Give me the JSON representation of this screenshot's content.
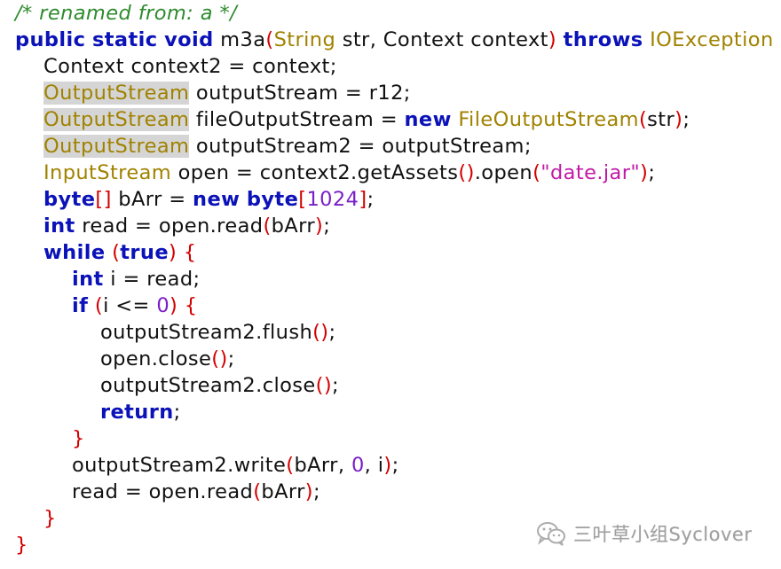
{
  "code": {
    "lines": [
      {
        "indent": 0,
        "tokens": [
          {
            "t": "/* renamed from: a */",
            "c": "comment"
          }
        ]
      },
      {
        "indent": 0,
        "tokens": [
          {
            "t": "public",
            "c": "kw"
          },
          {
            "t": " ",
            "c": "plain"
          },
          {
            "t": "static",
            "c": "kw"
          },
          {
            "t": " ",
            "c": "plain"
          },
          {
            "t": "void",
            "c": "kw"
          },
          {
            "t": " m3a",
            "c": "plain"
          },
          {
            "t": "(",
            "c": "punc"
          },
          {
            "t": "String",
            "c": "type"
          },
          {
            "t": " str, Context context",
            "c": "plain"
          },
          {
            "t": ")",
            "c": "punc"
          },
          {
            "t": " ",
            "c": "plain"
          },
          {
            "t": "throws",
            "c": "kw"
          },
          {
            "t": " ",
            "c": "plain"
          },
          {
            "t": "IOException",
            "c": "type"
          },
          {
            "t": " ",
            "c": "plain"
          },
          {
            "t": "{",
            "c": "punc"
          }
        ]
      },
      {
        "indent": 1,
        "tokens": [
          {
            "t": "Context context2 = context;",
            "c": "plain"
          }
        ]
      },
      {
        "indent": 1,
        "tokens": [
          {
            "t": "OutputStream",
            "c": "type hl"
          },
          {
            "t": " outputStream = r12;",
            "c": "plain"
          }
        ]
      },
      {
        "indent": 1,
        "tokens": [
          {
            "t": "OutputStream",
            "c": "type hl"
          },
          {
            "t": " fileOutputStream = ",
            "c": "plain"
          },
          {
            "t": "new",
            "c": "kw"
          },
          {
            "t": " ",
            "c": "plain"
          },
          {
            "t": "FileOutputStream",
            "c": "type"
          },
          {
            "t": "(",
            "c": "punc"
          },
          {
            "t": "str",
            "c": "plain"
          },
          {
            "t": ")",
            "c": "punc"
          },
          {
            "t": ";",
            "c": "plain"
          }
        ]
      },
      {
        "indent": 1,
        "tokens": [
          {
            "t": "OutputStream",
            "c": "type hl"
          },
          {
            "t": " outputStream2 = outputStream;",
            "c": "plain"
          }
        ]
      },
      {
        "indent": 1,
        "tokens": [
          {
            "t": "InputStream",
            "c": "type"
          },
          {
            "t": " open = context2.getAssets",
            "c": "plain"
          },
          {
            "t": "()",
            "c": "punc"
          },
          {
            "t": ".open",
            "c": "plain"
          },
          {
            "t": "(",
            "c": "punc"
          },
          {
            "t": "\"date.jar\"",
            "c": "str"
          },
          {
            "t": ")",
            "c": "punc"
          },
          {
            "t": ";",
            "c": "plain"
          }
        ]
      },
      {
        "indent": 1,
        "tokens": [
          {
            "t": "byte",
            "c": "kw"
          },
          {
            "t": "[]",
            "c": "punc"
          },
          {
            "t": " bArr = ",
            "c": "plain"
          },
          {
            "t": "new",
            "c": "kw"
          },
          {
            "t": " ",
            "c": "plain"
          },
          {
            "t": "byte",
            "c": "kw"
          },
          {
            "t": "[",
            "c": "punc"
          },
          {
            "t": "1024",
            "c": "num"
          },
          {
            "t": "]",
            "c": "punc"
          },
          {
            "t": ";",
            "c": "plain"
          }
        ]
      },
      {
        "indent": 1,
        "tokens": [
          {
            "t": "int",
            "c": "kw"
          },
          {
            "t": " read = open.read",
            "c": "plain"
          },
          {
            "t": "(",
            "c": "punc"
          },
          {
            "t": "bArr",
            "c": "plain"
          },
          {
            "t": ")",
            "c": "punc"
          },
          {
            "t": ";",
            "c": "plain"
          }
        ]
      },
      {
        "indent": 1,
        "tokens": [
          {
            "t": "while",
            "c": "kw"
          },
          {
            "t": " ",
            "c": "plain"
          },
          {
            "t": "(",
            "c": "punc"
          },
          {
            "t": "true",
            "c": "kw"
          },
          {
            "t": ")",
            "c": "punc"
          },
          {
            "t": " ",
            "c": "plain"
          },
          {
            "t": "{",
            "c": "punc"
          }
        ]
      },
      {
        "indent": 2,
        "tokens": [
          {
            "t": "int",
            "c": "kw"
          },
          {
            "t": " i = read;",
            "c": "plain"
          }
        ]
      },
      {
        "indent": 2,
        "tokens": [
          {
            "t": "if",
            "c": "kw"
          },
          {
            "t": " ",
            "c": "plain"
          },
          {
            "t": "(",
            "c": "punc"
          },
          {
            "t": "i <= ",
            "c": "plain"
          },
          {
            "t": "0",
            "c": "num"
          },
          {
            "t": ")",
            "c": "punc"
          },
          {
            "t": " ",
            "c": "plain"
          },
          {
            "t": "{",
            "c": "punc"
          }
        ]
      },
      {
        "indent": 3,
        "tokens": [
          {
            "t": "outputStream2.flush",
            "c": "plain"
          },
          {
            "t": "()",
            "c": "punc"
          },
          {
            "t": ";",
            "c": "plain"
          }
        ]
      },
      {
        "indent": 3,
        "tokens": [
          {
            "t": "open.close",
            "c": "plain"
          },
          {
            "t": "()",
            "c": "punc"
          },
          {
            "t": ";",
            "c": "plain"
          }
        ]
      },
      {
        "indent": 3,
        "tokens": [
          {
            "t": "outputStream2.close",
            "c": "plain"
          },
          {
            "t": "()",
            "c": "punc"
          },
          {
            "t": ";",
            "c": "plain"
          }
        ]
      },
      {
        "indent": 3,
        "tokens": [
          {
            "t": "return",
            "c": "kw"
          },
          {
            "t": ";",
            "c": "plain"
          }
        ]
      },
      {
        "indent": 2,
        "tokens": [
          {
            "t": "}",
            "c": "punc"
          }
        ]
      },
      {
        "indent": 2,
        "tokens": [
          {
            "t": "outputStream2.write",
            "c": "plain"
          },
          {
            "t": "(",
            "c": "punc"
          },
          {
            "t": "bArr, ",
            "c": "plain"
          },
          {
            "t": "0",
            "c": "num"
          },
          {
            "t": ", i",
            "c": "plain"
          },
          {
            "t": ")",
            "c": "punc"
          },
          {
            "t": ";",
            "c": "plain"
          }
        ]
      },
      {
        "indent": 2,
        "tokens": [
          {
            "t": "read = open.read",
            "c": "plain"
          },
          {
            "t": "(",
            "c": "punc"
          },
          {
            "t": "bArr",
            "c": "plain"
          },
          {
            "t": ")",
            "c": "punc"
          },
          {
            "t": ";",
            "c": "plain"
          }
        ]
      },
      {
        "indent": 1,
        "tokens": [
          {
            "t": "}",
            "c": "punc"
          }
        ]
      },
      {
        "indent": 0,
        "tokens": [
          {
            "t": "}",
            "c": "punc"
          }
        ]
      }
    ]
  },
  "colors": {
    "comment": "#2e8b2e",
    "keyword": "#0b12b8",
    "type": "#a08200",
    "highlight": "#d5d5d5",
    "punctuation": "#d40000",
    "number": "#7a1fc7",
    "string": "#c21aa6",
    "text": "#111111",
    "watermark": "#9a9a9a"
  },
  "watermark": {
    "icon": "wechat-icon",
    "text": "三叶草小组Syclover"
  }
}
